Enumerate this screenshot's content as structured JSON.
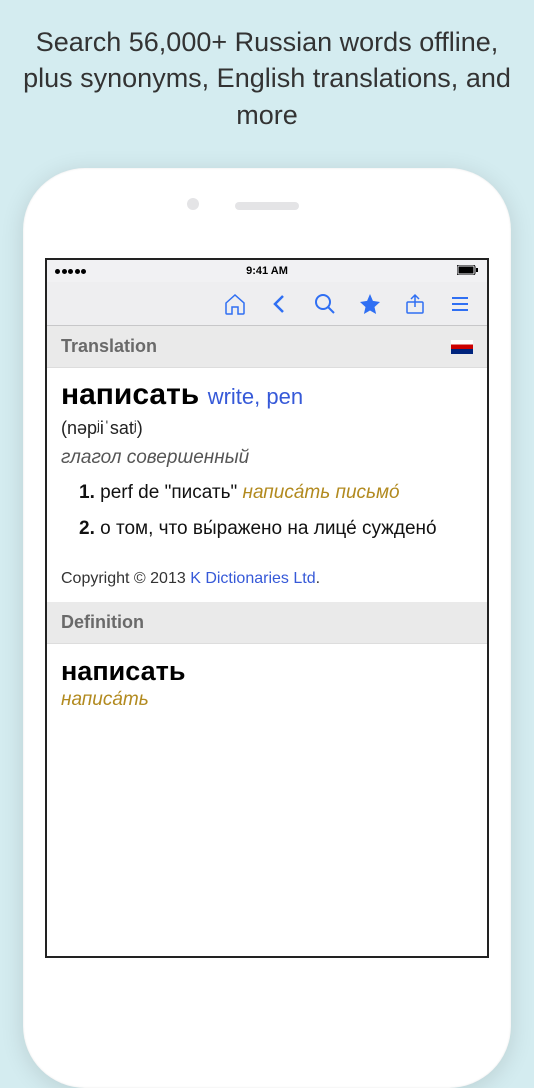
{
  "promo": "Search 56,000+ Russian words offline, plus synonyms, English translations, and more",
  "status": {
    "time": "9:41 AM"
  },
  "toolbar": {
    "home": "home",
    "back": "back",
    "search": "search",
    "star": "favorite",
    "share": "share",
    "menu": "menu"
  },
  "sections": {
    "translation": {
      "label": "Translation",
      "headword": "написать",
      "translation_inline": "write, pen",
      "pronunciation": "(nəpʲiˈsatʲ)",
      "pos": "глагол совершенный",
      "defs": [
        {
          "num": "1.",
          "text": "perf de \"писать\"",
          "example": "написа́ть письмо́"
        },
        {
          "num": "2.",
          "text": "о том, что вы́ражено на лице́ суждено́",
          "example": ""
        }
      ],
      "copyright_prefix": "Copyright © 2013 ",
      "copyright_link": "K Dictionaries Ltd",
      "copyright_suffix": "."
    },
    "definition": {
      "label": "Definition",
      "headword": "написать",
      "sub": "написа́ть"
    }
  }
}
